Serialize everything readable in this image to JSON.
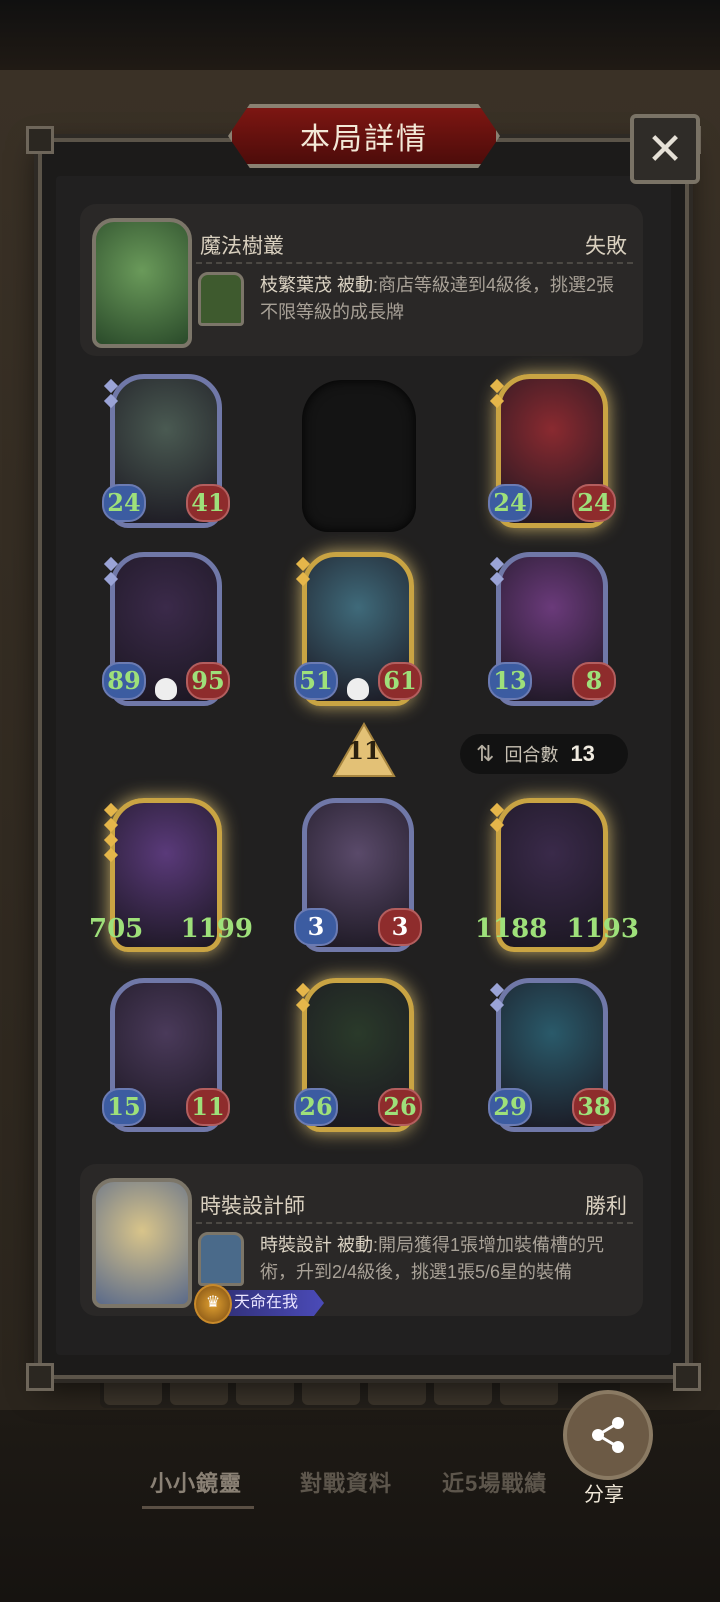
{
  "title": "本局詳情",
  "close_label": "✕",
  "opponent": {
    "name": "魔法樹叢",
    "result": "失敗",
    "skill_name": "枝繁葉茂",
    "skill_type": "被動",
    "skill_desc": ":商店等級達到4級後，挑選2張不限等級的成長牌"
  },
  "player": {
    "name": "時裝設計師",
    "result": "勝利",
    "skill_name": "時裝設計",
    "skill_type": "被動",
    "skill_desc": ":開局獲得1張增加裝備槽的咒術，升到2/4級後，挑選1張5/6星的裝備",
    "destiny_badge": "天命在我"
  },
  "opponent_units": [
    {
      "atk": "24",
      "hp": "41",
      "stars": 2,
      "gold": false,
      "color": "#4a5a52"
    },
    {
      "empty": true
    },
    {
      "atk": "24",
      "hp": "24",
      "stars": 2,
      "gold": true,
      "color": "#8a2a30"
    },
    {
      "atk": "89",
      "hp": "95",
      "stars": 2,
      "gold": false,
      "color": "#3b2a4a"
    },
    {
      "atk": "51",
      "hp": "61",
      "stars": 2,
      "gold": true,
      "color": "#3f6a7a"
    },
    {
      "atk": "13",
      "hp": "8",
      "stars": 2,
      "gold": false,
      "color": "#6a3a7a"
    }
  ],
  "turn_number": "11",
  "rounds_label": "回合數",
  "rounds_value": "13",
  "player_units": [
    {
      "atk": "705",
      "hp": "1199",
      "stars": 4,
      "gold": true,
      "color": "#5a3a7a"
    },
    {
      "atk": "3",
      "hp": "3",
      "stars": 0,
      "gold": false,
      "color": "#5a4a6a"
    },
    {
      "atk": "1188",
      "hp": "1193",
      "stars": 2,
      "gold": true,
      "color": "#3a2a4a"
    },
    {
      "atk": "15",
      "hp": "11",
      "stars": 0,
      "gold": false,
      "color": "#4a3a5a"
    },
    {
      "atk": "26",
      "hp": "26",
      "stars": 2,
      "gold": true,
      "color": "#2a3a2a"
    },
    {
      "atk": "29",
      "hp": "38",
      "stars": 2,
      "gold": false,
      "color": "#2a5a6a"
    }
  ],
  "share_label": "分享",
  "tabs": [
    "小小鏡靈",
    "對戰資料",
    "近5場戰績"
  ]
}
